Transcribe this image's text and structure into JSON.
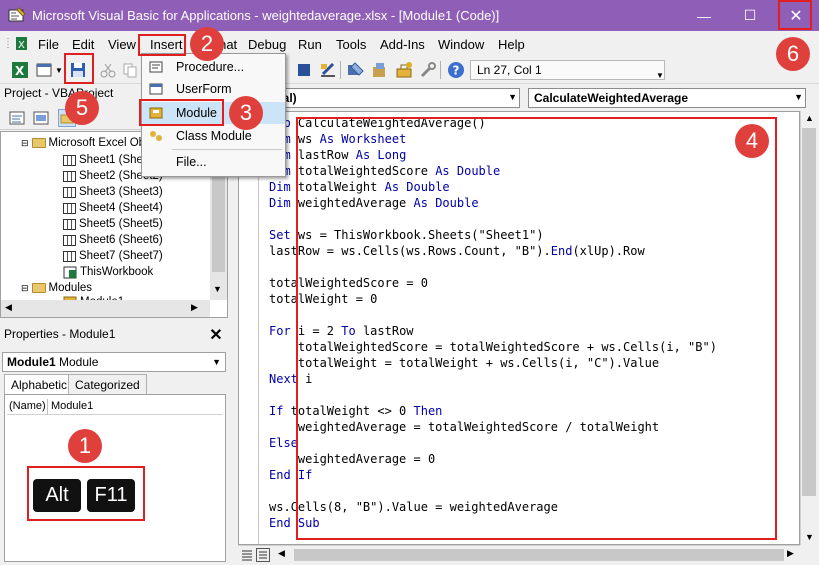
{
  "window": {
    "title": "Microsoft Visual Basic for Applications - weightedaverage.xlsx - [Module1 (Code)]",
    "minimize_glyph": "—",
    "maximize_glyph": "☐",
    "close_glyph": "✕"
  },
  "menu": {
    "items": [
      "File",
      "Edit",
      "View",
      "Insert",
      "Format",
      "Debug",
      "Run",
      "Tools",
      "Add-Ins",
      "Window",
      "Help"
    ],
    "insert_dropdown": [
      "Procedure...",
      "UserForm",
      "Module",
      "Class Module",
      "File..."
    ]
  },
  "toolbar": {
    "position": "Ln 27, Col 1"
  },
  "project": {
    "header": "Project - VBAProject",
    "tree": {
      "excel_objects": "Microsoft Excel Objects",
      "sheets": [
        "Sheet1 (Sheet1)",
        "Sheet2 (Sheet2)",
        "Sheet3 (Sheet3)",
        "Sheet4 (Sheet4)",
        "Sheet5 (Sheet5)",
        "Sheet6 (Sheet6)",
        "Sheet7 (Sheet7)"
      ],
      "this_workbook": "ThisWorkbook",
      "modules": "Modules",
      "module1": "Module1"
    }
  },
  "properties": {
    "header": "Properties - Module1",
    "close_glyph": "✕",
    "object_name": "Module1",
    "object_type": "Module",
    "tab_alphabetic": "Alphabetic",
    "tab_categorized": "Categorized",
    "name_key": "(Name)",
    "name_value": "Module1"
  },
  "keys": {
    "key1": "Alt",
    "key2": "F11"
  },
  "code": {
    "object_combo": "(General)",
    "proc_combo": "CalculateWeightedAverage",
    "lines": [
      "Sub CalculateWeightedAverage()",
      "Dim ws As Worksheet",
      "Dim lastRow As Long",
      "Dim totalWeightedScore As Double",
      "Dim totalWeight As Double",
      "Dim weightedAverage As Double",
      "",
      "Set ws = ThisWorkbook.Sheets(\"Sheet1\")",
      "lastRow = ws.Cells(ws.Rows.Count, \"B\").End(xlUp).Row",
      "",
      "totalWeightedScore = 0",
      "totalWeight = 0",
      "",
      "For i = 2 To lastRow",
      "    totalWeightedScore = totalWeightedScore + ws.Cells(i, \"B\")",
      "    totalWeight = totalWeight + ws.Cells(i, \"C\").Value",
      "Next i",
      "",
      "If totalWeight <> 0 Then",
      "    weightedAverage = totalWeightedScore / totalWeight",
      "Else",
      "    weightedAverage = 0",
      "End If",
      "",
      "ws.Cells(8, \"B\").Value = weightedAverage",
      "End Sub"
    ]
  },
  "badges": [
    "1",
    "2",
    "3",
    "4",
    "5",
    "6"
  ],
  "colors": {
    "titlebar": "#8f5fb8",
    "highlight": "#e02020",
    "badge": "#e0403c",
    "keyword": "#0000a8"
  }
}
